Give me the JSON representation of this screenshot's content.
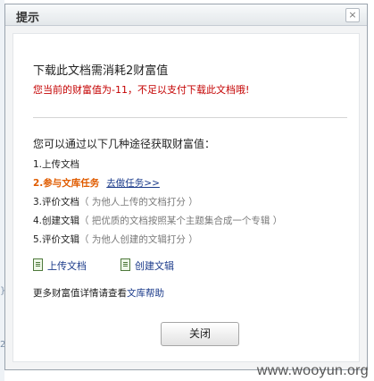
{
  "dialog": {
    "title": "提示",
    "close_icon": "×",
    "cost_text": "下载此文档需消耗2财富值",
    "warning_text": "您当前的财富值为-11，不足以支付下载此文档哦!",
    "ways_heading": "您可以通过以下几种途径获取财富值：",
    "items": [
      {
        "text": "1.上传文档",
        "hint": "",
        "link": ""
      },
      {
        "text": "2.参与文库任务",
        "hint": "",
        "link": "去做任务>>"
      },
      {
        "text": "3.评价文档",
        "hint": "（ 为他人上传的文档打分 ）",
        "link": ""
      },
      {
        "text": "4.创建文辑",
        "hint": "（ 把优质的文档按照某个主题集合成一个专辑 ）",
        "link": ""
      },
      {
        "text": "5.评价文辑",
        "hint": "（ 为他人创建的文辑打分 ）",
        "link": ""
      }
    ],
    "upload_link": "上传文档",
    "create_link": "创建文辑",
    "more_prefix": "更多财富值详情请查看",
    "help_link": "文库帮助",
    "close_button": "关闭"
  },
  "page_edge": {
    "text1": "}",
    "text2": "2"
  },
  "watermark": "www.wooyun.org",
  "colors": {
    "warning": "#c40000",
    "highlight": "#e05c00",
    "link": "#1a3a8a"
  }
}
